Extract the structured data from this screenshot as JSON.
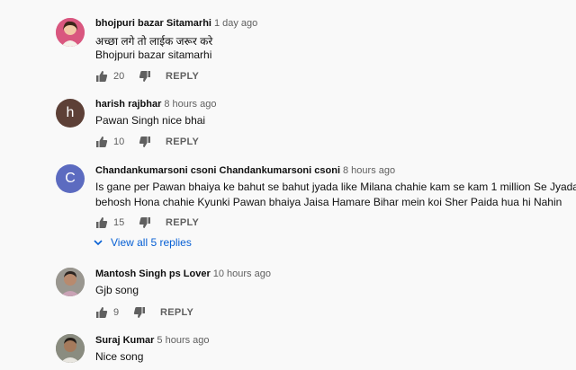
{
  "comments": [
    {
      "author": "bhojpuri bazar Sitamarhi",
      "time": "1 day ago",
      "lines": [
        "अच्छा लगे तो लाईक जरूर करे",
        "Bhojpuri bazar sitamarhi"
      ],
      "likes": "20",
      "reply_label": "REPLY",
      "avatar_color": "#e06aa0"
    },
    {
      "author": "harish rajbhar",
      "time": "8 hours ago",
      "lines": [
        "Pawan Singh nice bhai"
      ],
      "likes": "10",
      "reply_label": "REPLY",
      "avatar_letter": "h",
      "avatar_color": "#5d4037"
    },
    {
      "author": "Chandankumarsoni csoni Chandankumarsoni csoni",
      "time": "8 hours ago",
      "lines": [
        "Is gane per Pawan bhaiya ke bahut se bahut jyada like Milana chahie kam se kam 1 million Se Jyada",
        "behosh Hona chahie Kyunki Pawan bhaiya Jaisa Hamare Bihar mein koi Sher Paida hua hi Nahin"
      ],
      "likes": "15",
      "reply_label": "REPLY",
      "avatar_letter": "C",
      "avatar_color": "#5c6bc0",
      "view_replies": "View all 5 replies"
    },
    {
      "author": "Mantosh Singh ps Lover",
      "time": "10 hours ago",
      "lines": [
        "Gjb song"
      ],
      "likes": "9",
      "reply_label": "REPLY",
      "avatar_color": "#8d8b86"
    },
    {
      "author": "Suraj Kumar",
      "time": "5 hours ago",
      "lines": [
        "Nice song"
      ],
      "avatar_color": "#7a7d72"
    }
  ],
  "colors": {
    "link": "#065fd4",
    "meta": "#606060"
  }
}
